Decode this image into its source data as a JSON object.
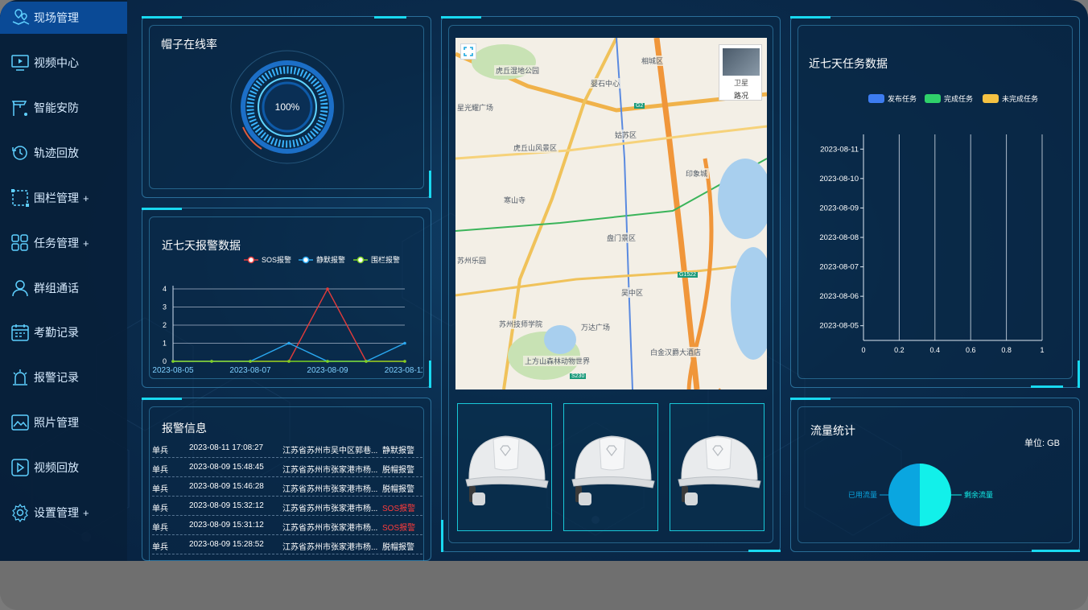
{
  "sidebar": {
    "items": [
      {
        "label": "现场管理",
        "icon": "map-pin-icon",
        "active": true,
        "expandable": false
      },
      {
        "label": "视频中心",
        "icon": "monitor-play-icon",
        "active": false,
        "expandable": false
      },
      {
        "label": "智能安防",
        "icon": "security-camera-icon",
        "active": false,
        "expandable": false
      },
      {
        "label": "轨迹回放",
        "icon": "history-icon",
        "active": false,
        "expandable": false
      },
      {
        "label": "围栏管理",
        "icon": "fence-icon",
        "active": false,
        "expandable": true
      },
      {
        "label": "任务管理",
        "icon": "grid-apps-icon",
        "active": false,
        "expandable": true
      },
      {
        "label": "群组通话",
        "icon": "user-group-icon",
        "active": false,
        "expandable": false
      },
      {
        "label": "考勤记录",
        "icon": "calendar-icon",
        "active": false,
        "expandable": false
      },
      {
        "label": "报警记录",
        "icon": "alarm-icon",
        "active": false,
        "expandable": false
      },
      {
        "label": "照片管理",
        "icon": "photo-icon",
        "active": false,
        "expandable": false
      },
      {
        "label": "视频回放",
        "icon": "play-icon",
        "active": false,
        "expandable": false
      },
      {
        "label": "设置管理",
        "icon": "gear-icon",
        "active": false,
        "expandable": true
      }
    ],
    "plus": "+"
  },
  "online_rate": {
    "title": "帽子在线率",
    "value_label": "100%",
    "value": 1.0
  },
  "alarm_chart": {
    "title": "近七天报警数据",
    "chart_data": {
      "type": "line",
      "x": [
        "2023-08-05",
        "2023-08-06",
        "2023-08-07",
        "2023-08-08",
        "2023-08-09",
        "2023-08-10",
        "2023-08-11"
      ],
      "x_tick_labels": [
        "2023-08-05",
        "2023-08-07",
        "2023-08-09",
        "2023-08-11"
      ],
      "series": [
        {
          "name": "SOS报警",
          "color": "#e23b3b",
          "values": [
            0,
            0,
            0,
            0,
            4,
            0,
            0
          ]
        },
        {
          "name": "静默报警",
          "color": "#2aa8f0",
          "values": [
            0,
            0,
            0,
            1,
            0,
            0,
            1
          ]
        },
        {
          "name": "围栏报警",
          "color": "#7ed321",
          "values": [
            0,
            0,
            0,
            0,
            0,
            0,
            0
          ]
        }
      ],
      "ylim": [
        0,
        4
      ],
      "yticks": [
        "0",
        "1",
        "2",
        "3",
        "4"
      ],
      "grid": true,
      "legend": "top"
    }
  },
  "alarm_info": {
    "title": "报警信息",
    "rows": [
      {
        "type": "单兵",
        "time": "2023-08-11 17:08:27",
        "location": "江苏省苏州市吴中区郭巷...",
        "alarm": "静默报警",
        "sos": false
      },
      {
        "type": "单兵",
        "time": "2023-08-09 15:48:45",
        "location": "江苏省苏州市张家港市杨...",
        "alarm": "脱帽报警",
        "sos": false
      },
      {
        "type": "单兵",
        "time": "2023-08-09 15:46:28",
        "location": "江苏省苏州市张家港市杨...",
        "alarm": "脱帽报警",
        "sos": false
      },
      {
        "type": "单兵",
        "time": "2023-08-09 15:32:12",
        "location": "江苏省苏州市张家港市杨...",
        "alarm": "SOS报警",
        "sos": true
      },
      {
        "type": "单兵",
        "time": "2023-08-09 15:31:12",
        "location": "江苏省苏州市张家港市杨...",
        "alarm": "SOS报警",
        "sos": true
      },
      {
        "type": "单兵",
        "time": "2023-08-09 15:28:52",
        "location": "江苏省苏州市张家港市杨...",
        "alarm": "脱帽报警",
        "sos": false
      }
    ]
  },
  "map": {
    "satellite_label": "卫星",
    "traffic_label": "路况",
    "labels": [
      {
        "text": "虎丘湿地公园"
      },
      {
        "text": "相城区"
      },
      {
        "text": "婴石中心"
      },
      {
        "text": "星光耀广场"
      },
      {
        "text": "姑苏区"
      },
      {
        "text": "虎丘山风景区"
      },
      {
        "text": "印象城"
      },
      {
        "text": "寒山寺"
      },
      {
        "text": "盘门景区"
      },
      {
        "text": "苏州乐园"
      },
      {
        "text": "吴中区"
      },
      {
        "text": "苏州技师学院"
      },
      {
        "text": "万达广场"
      },
      {
        "text": "上方山森林动物世界"
      },
      {
        "text": "白金汉爵大酒店"
      },
      {
        "text": "G2"
      },
      {
        "text": "G1522"
      },
      {
        "text": "S230"
      }
    ]
  },
  "helmets": [
    {
      "icon": "helmet-icon"
    },
    {
      "icon": "helmet-icon"
    },
    {
      "icon": "helmet-icon"
    }
  ],
  "task_chart": {
    "title": "近七天任务数据",
    "chart_data": {
      "type": "bar",
      "orientation": "horizontal",
      "categories": [
        "2023-08-05",
        "2023-08-06",
        "2023-08-07",
        "2023-08-08",
        "2023-08-09",
        "2023-08-10",
        "2023-08-11"
      ],
      "series": [
        {
          "name": "发布任务",
          "color": "#3d7cf0",
          "values": [
            0,
            0,
            0,
            0,
            0,
            0,
            0
          ]
        },
        {
          "name": "完成任务",
          "color": "#2fd16a",
          "values": [
            0,
            0,
            0,
            0,
            0,
            0,
            0
          ]
        },
        {
          "name": "未完成任务",
          "color": "#f5c242",
          "values": [
            0,
            0,
            0,
            0,
            0,
            0,
            0
          ]
        }
      ],
      "xlim": [
        0,
        1
      ],
      "xticks": [
        "0",
        "0.2",
        "0.4",
        "0.6",
        "0.8",
        "1"
      ],
      "grid": true,
      "legend": "top"
    }
  },
  "traffic": {
    "title": "流量统计",
    "unit": "单位: GB",
    "chart_data": {
      "type": "pie",
      "slices": [
        {
          "name": "已用流量",
          "value": 50,
          "color": "#0aa6e0"
        },
        {
          "name": "剩余流量",
          "value": 50,
          "color": "#12f0ea"
        }
      ]
    }
  }
}
